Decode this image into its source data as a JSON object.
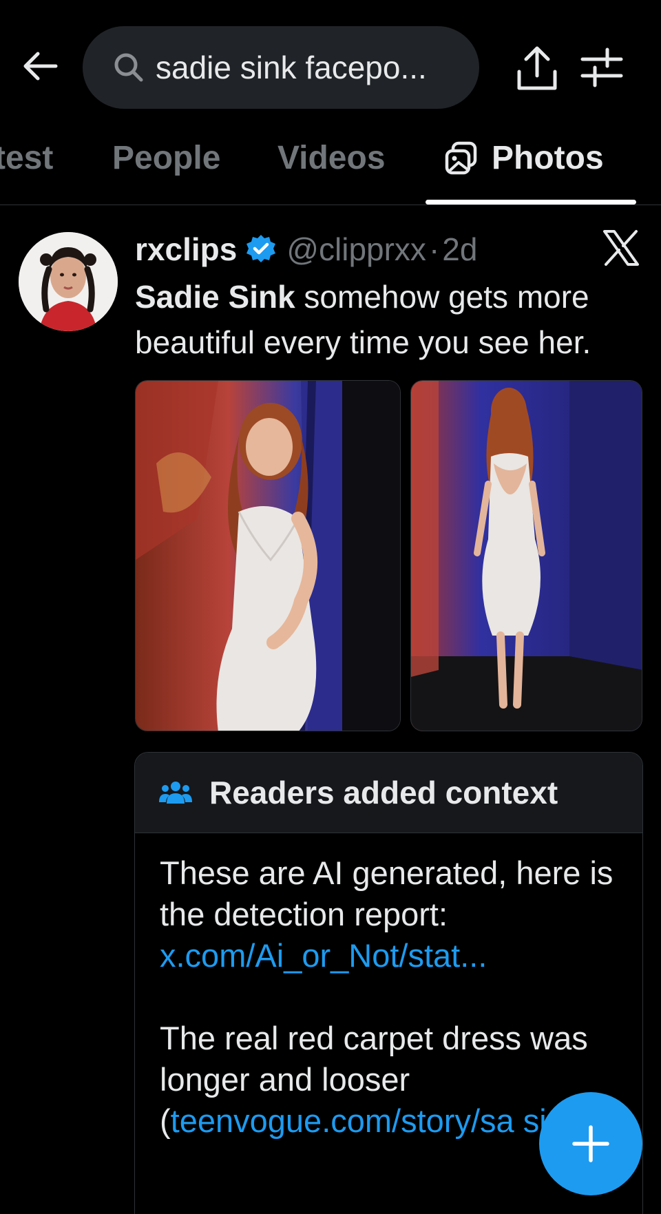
{
  "search": {
    "query": "sadie sink facepo..."
  },
  "tabs": [
    {
      "label": "test"
    },
    {
      "label": "People"
    },
    {
      "label": "Videos"
    },
    {
      "label": "Photos",
      "active": true
    }
  ],
  "post": {
    "name": "rxclips",
    "handle": "@clipprxx",
    "separator": "·",
    "time": "2d",
    "text_bold": "Sadie Sink",
    "text_rest": " somehow gets more beautiful every time you see her.",
    "photos": [
      {
        "icon": "photo-front"
      },
      {
        "icon": "photo-back"
      }
    ]
  },
  "context": {
    "title": "Readers added context",
    "para1": "These are AI generated, here is the detection report:",
    "link1": "x.com/Ai_or_Not/stat...",
    "para2": "The real red carpet dress was longer and looser",
    "open_paren": "(",
    "link2": "teenvogue.com/story/sa si...",
    "close": ")."
  },
  "colors": {
    "background": "#000000",
    "text": "#e7e9ea",
    "muted": "#71767b",
    "accent": "#1d9bf0",
    "pill": "#202327"
  }
}
